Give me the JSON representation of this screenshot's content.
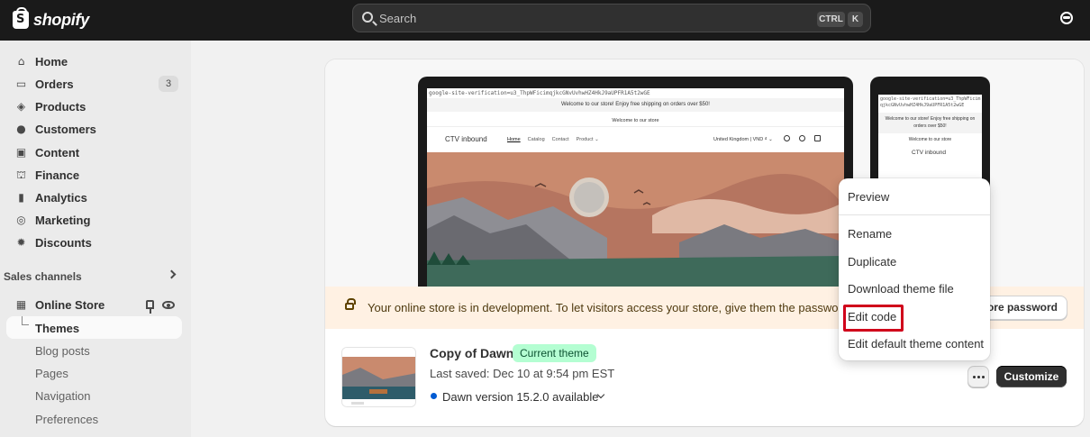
{
  "topbar": {
    "brand": "shopify",
    "search_placeholder": "Search",
    "shortcut_ctrl": "CTRL",
    "shortcut_k": "K"
  },
  "sidebar": {
    "items": [
      {
        "label": "Home",
        "icon": "home-icon"
      },
      {
        "label": "Orders",
        "icon": "inbox-icon",
        "badge": "3"
      },
      {
        "label": "Products",
        "icon": "tag-icon"
      },
      {
        "label": "Customers",
        "icon": "person-icon"
      },
      {
        "label": "Content",
        "icon": "image-icon"
      },
      {
        "label": "Finance",
        "icon": "bank-icon"
      },
      {
        "label": "Analytics",
        "icon": "bar-chart-icon"
      },
      {
        "label": "Marketing",
        "icon": "target-icon"
      },
      {
        "label": "Discounts",
        "icon": "discount-icon"
      }
    ],
    "sales_channels_label": "Sales channels",
    "online_store_label": "Online Store",
    "sub_items": [
      "Themes",
      "Blog posts",
      "Pages",
      "Navigation",
      "Preferences"
    ]
  },
  "preview": {
    "verification": "google-site-verification=u3_ThpWFicimqjkcGNvUvhwHZ4HkJ9aUPFR1A5t2wGE",
    "announcement": "Welcome to our store! Enjoy free shipping on orders over $50!",
    "welcome": "Welcome to our store",
    "store_name": "CTV inbound",
    "nav": [
      "Home",
      "Catalog",
      "Contact",
      "Product ⌄"
    ],
    "region": "United Kingdom | VND ₫ ⌄",
    "phone_verification": "google-site-verification=u3_ThpWFicimqjkcGNvUvhwHZ4HkJ9aUPFR1A5t2wGE",
    "phone_announcement": "Welcome to our store! Enjoy free shipping on orders over $50!",
    "phone_welcome": "Welcome to our store",
    "phone_store_name": "CTV inbound"
  },
  "banner": {
    "text": "Your online store is in development. To let visitors access your store, give them the password.",
    "button": "tore password"
  },
  "theme": {
    "name": "Copy of Dawn",
    "badge": "Current theme",
    "last_saved": "Last saved: Dec 10 at 9:54 pm EST",
    "version": "Dawn version 15.2.0 available",
    "customize": "Customize"
  },
  "menu": {
    "items": [
      "Preview",
      "Rename",
      "Duplicate",
      "Download theme file",
      "Edit code",
      "Edit default theme content"
    ]
  },
  "colors": {
    "topbar": "#1a1a1a",
    "banner": "#fff1e3",
    "badge_green": "#b4fed2",
    "highlight": "#d0021b"
  }
}
